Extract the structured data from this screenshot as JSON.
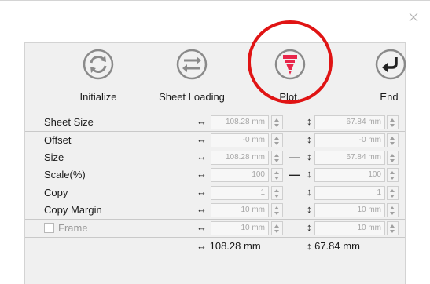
{
  "toolbar": {
    "initialize_label": "Initialize",
    "sheet_loading_label": "Sheet Loading",
    "plot_label": "Plot...",
    "end_label": "End",
    "plot_icon_color": "#e8264a",
    "highlight_color": "#e01414"
  },
  "rows": {
    "sheet_size": {
      "label": "Sheet Size",
      "width": "108.28 mm",
      "height": "67.84 mm"
    },
    "offset": {
      "label": "Offset",
      "width": "-0 mm",
      "height": "-0 mm"
    },
    "size": {
      "label": "Size",
      "width": "108.28 mm",
      "height": "67.84 mm"
    },
    "scale": {
      "label": "Scale(%)",
      "width": "100",
      "height": "100"
    },
    "copy": {
      "label": "Copy",
      "width": "1",
      "height": "1"
    },
    "copy_margin": {
      "label": "Copy Margin",
      "width": "10 mm",
      "height": "10 mm"
    },
    "frame": {
      "label": "Frame",
      "width": "10 mm",
      "height": "10 mm",
      "checked": false
    }
  },
  "symbols": {
    "horizontal": "↔",
    "vertical": "↕",
    "lock": "—"
  },
  "totals": {
    "width": "↔ 108.28 mm",
    "height": "↕ 67.84 mm"
  }
}
